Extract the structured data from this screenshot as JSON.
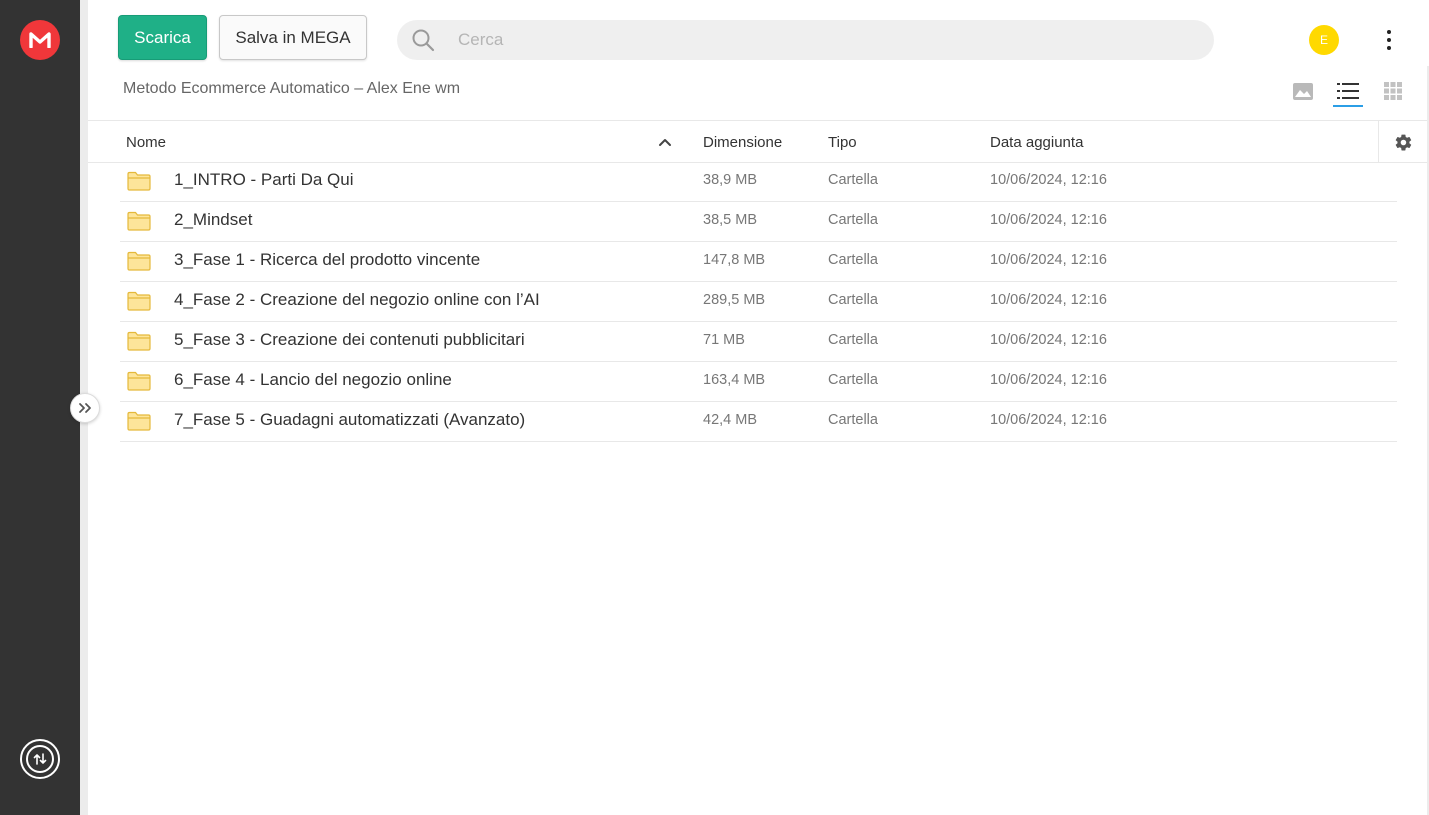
{
  "toolbar": {
    "download_label": "Scarica",
    "save_label": "Salva in MEGA"
  },
  "search": {
    "placeholder": "Cerca",
    "value": ""
  },
  "account": {
    "avatar_letter": "E",
    "avatar_color": "#ffd900"
  },
  "breadcrumb": {
    "title": "Metodo Ecommerce Automatico – Alex Ene wm"
  },
  "columns": {
    "name": "Nome",
    "size": "Dimensione",
    "type": "Tipo",
    "date": "Data aggiunta"
  },
  "colors": {
    "accent": "#1fb087",
    "brand": "#f0373a",
    "rail": "#333333",
    "active_view": "#2b9ee6",
    "folder": "#f8d775"
  },
  "icons": [
    "mega-logo-icon",
    "transfer-icon",
    "expand-chevrons-icon",
    "search-icon",
    "kebab-menu-icon",
    "thumbnail-view-icon",
    "list-view-icon",
    "grid-view-icon",
    "sort-ascending-icon",
    "gear-icon",
    "folder-icon"
  ],
  "files": [
    {
      "name": "1_INTRO - Parti Da Qui",
      "size": "38,9 MB",
      "type": "Cartella",
      "date": "10/06/2024, 12:16"
    },
    {
      "name": "2_Mindset",
      "size": "38,5 MB",
      "type": "Cartella",
      "date": "10/06/2024, 12:16"
    },
    {
      "name": "3_Fase 1 - Ricerca del prodotto vincente",
      "size": "147,8 MB",
      "type": "Cartella",
      "date": "10/06/2024, 12:16"
    },
    {
      "name": "4_Fase 2 - Creazione del negozio online con l’AI",
      "size": "289,5 MB",
      "type": "Cartella",
      "date": "10/06/2024, 12:16"
    },
    {
      "name": "5_Fase 3 - Creazione dei contenuti pubblicitari",
      "size": "71 MB",
      "type": "Cartella",
      "date": "10/06/2024, 12:16"
    },
    {
      "name": "6_Fase 4 - Lancio del negozio online",
      "size": "163,4 MB",
      "type": "Cartella",
      "date": "10/06/2024, 12:16"
    },
    {
      "name": "7_Fase 5 - Guadagni automatizzati (Avanzato)",
      "size": "42,4 MB",
      "type": "Cartella",
      "date": "10/06/2024, 12:16"
    }
  ]
}
